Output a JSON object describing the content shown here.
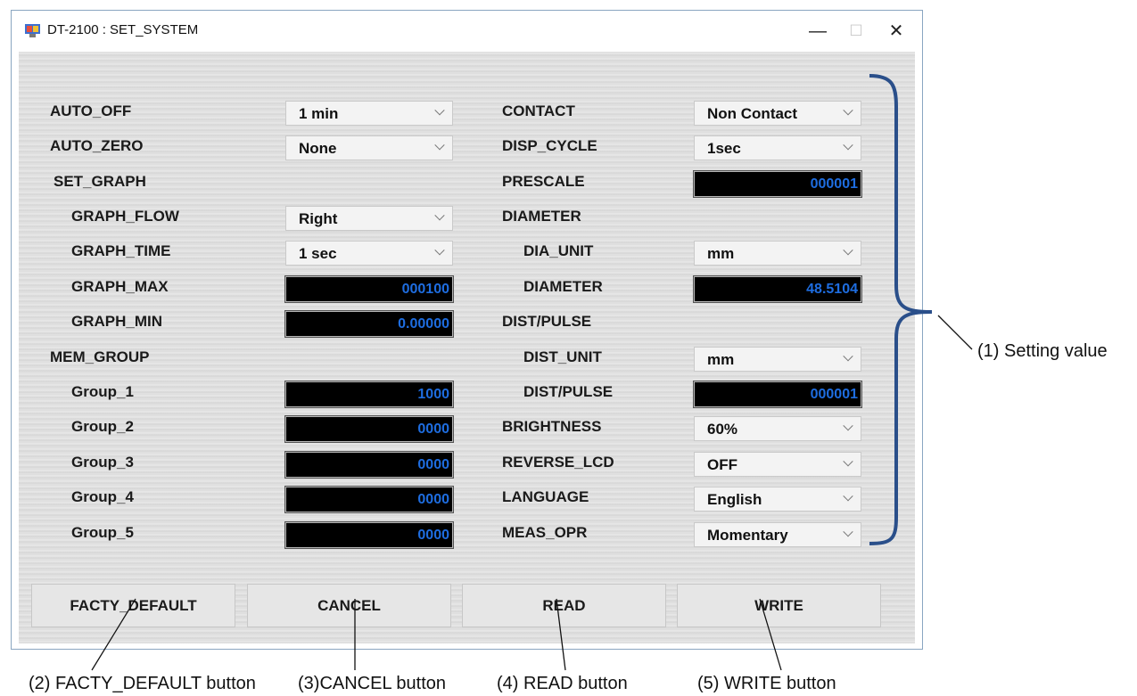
{
  "window": {
    "title": "DT-2100 : SET_SYSTEM",
    "minimize": "—",
    "maximize": "☐",
    "close": "✕"
  },
  "left": {
    "auto_off": {
      "label": "AUTO_OFF",
      "value": "1 min"
    },
    "auto_zero": {
      "label": "AUTO_ZERO",
      "value": "None"
    },
    "set_graph": {
      "label": "SET_GRAPH"
    },
    "graph_flow": {
      "label": "GRAPH_FLOW",
      "value": "Right"
    },
    "graph_time": {
      "label": "GRAPH_TIME",
      "value": "1 sec"
    },
    "graph_max": {
      "label": "GRAPH_MAX",
      "value": "000100"
    },
    "graph_min": {
      "label": "GRAPH_MIN",
      "value": "0.00000"
    },
    "mem_group": {
      "label": "MEM_GROUP"
    },
    "groups": [
      {
        "label": "Group_1",
        "value": "1000"
      },
      {
        "label": "Group_2",
        "value": "0000"
      },
      {
        "label": "Group_3",
        "value": "0000"
      },
      {
        "label": "Group_4",
        "value": "0000"
      },
      {
        "label": "Group_5",
        "value": "0000"
      }
    ]
  },
  "right": {
    "contact": {
      "label": "CONTACT",
      "value": "Non Contact"
    },
    "disp_cycle": {
      "label": "DISP_CYCLE",
      "value": "1sec"
    },
    "prescale": {
      "label": "PRESCALE",
      "value": "000001"
    },
    "diameter_group": {
      "label": "DIAMETER"
    },
    "dia_unit": {
      "label": "DIA_UNIT",
      "value": "mm"
    },
    "diameter": {
      "label": "DIAMETER",
      "value": "48.5104"
    },
    "dist_pulse_group": {
      "label": "DIST/PULSE"
    },
    "dist_unit": {
      "label": "DIST_UNIT",
      "value": "mm"
    },
    "dist_pulse": {
      "label": "DIST/PULSE",
      "value": "000001"
    },
    "brightness": {
      "label": "BRIGHTNESS",
      "value": "60%"
    },
    "reverse_lcd": {
      "label": "REVERSE_LCD",
      "value": "OFF"
    },
    "language": {
      "label": "LANGUAGE",
      "value": "English"
    },
    "meas_opr": {
      "label": "MEAS_OPR",
      "value": "Momentary"
    }
  },
  "buttons": {
    "facty_default": "FACTY_DEFAULT",
    "cancel": "CANCEL",
    "read": "READ",
    "write": "WRITE"
  },
  "annotations": {
    "setting_value": "(1) Setting value",
    "facty_default": "(2) FACTY_DEFAULT button",
    "cancel": "(3)CANCEL button",
    "read": "(4) READ button",
    "write": "(5) WRITE button"
  },
  "colors": {
    "numeric_text": "#1e6de0",
    "bracket": "#2a4f8a"
  }
}
